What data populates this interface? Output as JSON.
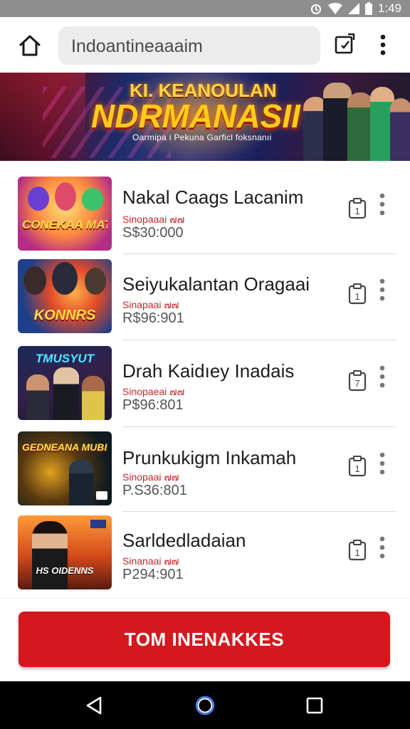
{
  "status_bar": {
    "time": "1:49",
    "icons": [
      "alarm-icon",
      "wifi-icon",
      "signal-icon",
      "battery-icon"
    ]
  },
  "toolbar": {
    "url_text": "Indoantineaaaim",
    "icons": [
      "home-icon",
      "tab-switch-icon",
      "overflow-menu-icon"
    ]
  },
  "banner": {
    "line1": "KI. KEANOULAN",
    "line2": "NDRMANASII",
    "line3": "Oarmipa i Pekuna Garficl foksnanıi"
  },
  "items": [
    {
      "title": "Nakal Caags Lacanim",
      "subtitle": "Sinopaaai ๗๗",
      "price": "S$30:000",
      "thumb_label": "CONEKAA MATAN",
      "clip_number": "1"
    },
    {
      "title": "Seiyukalantan Oragaai",
      "subtitle": "Sinapaai ๗๗",
      "price": "R$96:901",
      "thumb_label": "KONNRS",
      "clip_number": "1"
    },
    {
      "title": "Drah Kaidıey Inadais",
      "subtitle": "Sinopaeai ๗๗",
      "price": "P$96:801",
      "thumb_label": "TMUSYUT",
      "clip_number": "7"
    },
    {
      "title": "Prunkukigm Inkamah",
      "subtitle": "Sinopaai ๗๗",
      "price": "P.S36:801",
      "thumb_label": "GEDNEANA MUBIENS",
      "clip_number": "1"
    },
    {
      "title": "Sarldedladaian",
      "subtitle": "Sinanaai ๗๗",
      "price": "P294:901",
      "thumb_label": "HS OIDENNS",
      "clip_number": "1"
    }
  ],
  "cta": {
    "label": "TOM INENAKKES"
  },
  "nav_bar": {
    "icons": [
      "back-icon",
      "home-circle-icon",
      "recents-icon"
    ]
  },
  "colors": {
    "accent_red": "#d3191e",
    "status_bar": "#8e8e8e",
    "url_bg": "#ececec",
    "subtitle_red": "#c4272b"
  }
}
